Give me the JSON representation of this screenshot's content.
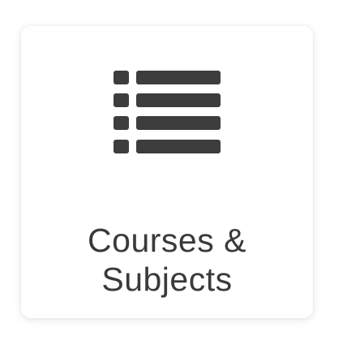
{
  "tile": {
    "label_line1": "Courses &",
    "label_line2": "Subjects",
    "icon": "list-icon",
    "icon_color": "#3d3d3d",
    "text_color": "#3a3a3a",
    "background": "#ffffff"
  }
}
